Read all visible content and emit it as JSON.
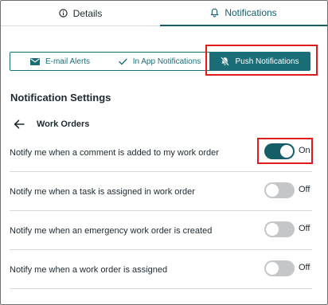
{
  "tabs": {
    "details": {
      "label": "Details",
      "icon": "info-circle-icon"
    },
    "notifications": {
      "label": "Notifications",
      "icon": "bell-icon",
      "active": true
    }
  },
  "channels": {
    "email": {
      "label": "E-mail Alerts",
      "icon": "envelope-icon"
    },
    "in_app": {
      "label": "In App Notifications",
      "icon": "checkmark-icon"
    },
    "push": {
      "label": "Push Notifications",
      "icon": "bell-slash-icon",
      "selected": true
    }
  },
  "section_title": "Notification Settings",
  "group": {
    "label": "Work Orders",
    "back_icon": "arrow-left-icon"
  },
  "settings": [
    {
      "label": "Notify me when a comment is added to my work order",
      "enabled": true,
      "state": "On"
    },
    {
      "label": "Notify me when a task is assigned in work order",
      "enabled": false,
      "state": "Off"
    },
    {
      "label": "Notify me when an emergency work order is created",
      "enabled": false,
      "state": "Off"
    },
    {
      "label": "Notify me when a work order is assigned",
      "enabled": false,
      "state": "Off"
    }
  ],
  "colors": {
    "accent": "#155e66",
    "segment_active": "#1b6e78",
    "toggle_off": "#c4c7c9",
    "highlight": "#e01b1b"
  }
}
